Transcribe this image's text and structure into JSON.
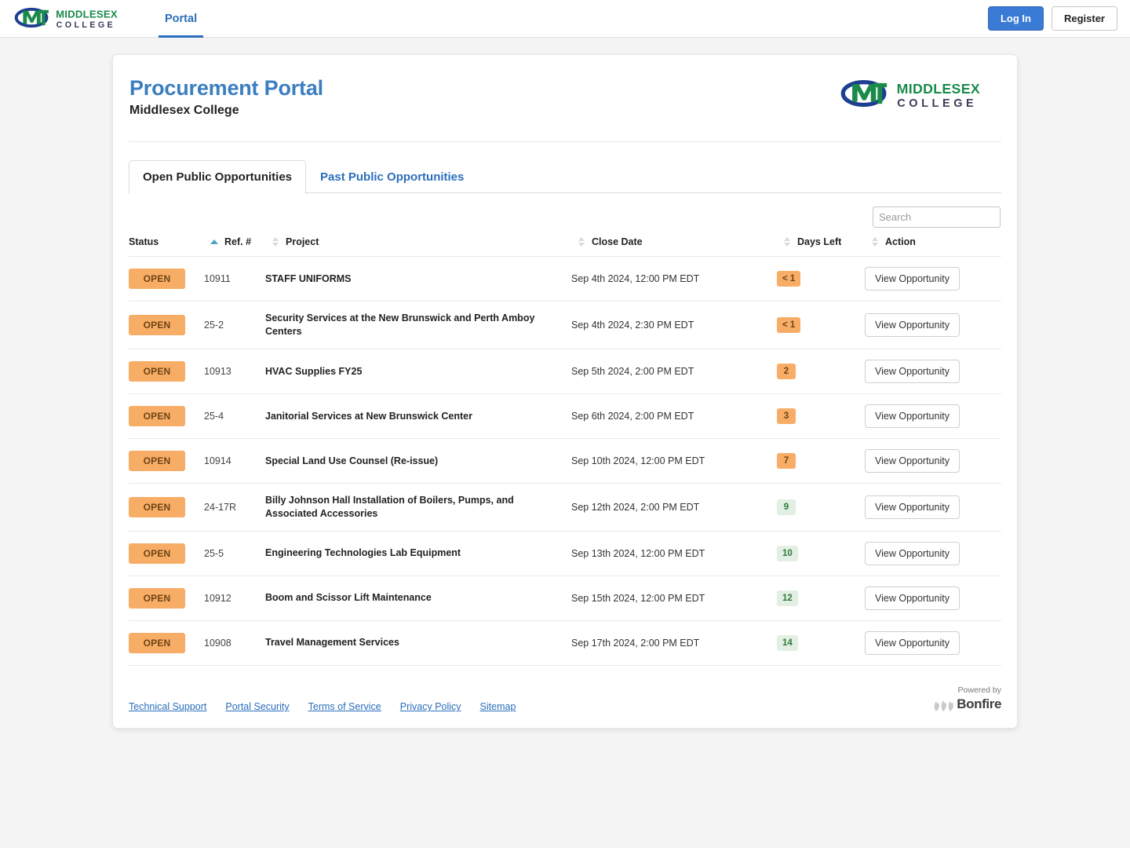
{
  "topnav": {
    "brand_line1": "MIDDLESEX",
    "brand_line2": "C O L L E G E",
    "nav_items": [
      {
        "label": "Portal",
        "active": true
      }
    ],
    "login_label": "Log In",
    "register_label": "Register"
  },
  "header": {
    "title": "Procurement Portal",
    "subtitle": "Middlesex College",
    "logo_line1": "MIDDLESEX",
    "logo_line2": "COLLEGE"
  },
  "tabs": [
    {
      "label": "Open Public Opportunities",
      "active": true
    },
    {
      "label": "Past Public Opportunities",
      "active": false
    }
  ],
  "search": {
    "value": "",
    "placeholder": "Search"
  },
  "table": {
    "columns": [
      {
        "label": "Status",
        "sort": "asc"
      },
      {
        "label": "Ref. #",
        "sort": "both"
      },
      {
        "label": "Project",
        "sort": "both"
      },
      {
        "label": "Close Date",
        "sort": "both"
      },
      {
        "label": "Days Left",
        "sort": "both"
      },
      {
        "label": "Action",
        "sort": "none"
      }
    ],
    "action_label": "View Opportunity",
    "rows": [
      {
        "status": "OPEN",
        "ref": "10911",
        "project": "STAFF UNIFORMS",
        "close_date": "Sep 4th 2024, 12:00 PM EDT",
        "days_left": "< 1",
        "days_state": "warn"
      },
      {
        "status": "OPEN",
        "ref": "25-2",
        "project": "Security Services at the New Brunswick and Perth Amboy Centers",
        "close_date": "Sep 4th 2024, 2:30 PM EDT",
        "days_left": "< 1",
        "days_state": "warn"
      },
      {
        "status": "OPEN",
        "ref": "10913",
        "project": "HVAC Supplies FY25",
        "close_date": "Sep 5th 2024, 2:00 PM EDT",
        "days_left": "2",
        "days_state": "warn"
      },
      {
        "status": "OPEN",
        "ref": "25-4",
        "project": "Janitorial Services at New Brunswick Center",
        "close_date": "Sep 6th 2024, 2:00 PM EDT",
        "days_left": "3",
        "days_state": "warn"
      },
      {
        "status": "OPEN",
        "ref": "10914",
        "project": "Special Land Use Counsel (Re-issue)",
        "close_date": "Sep 10th 2024, 12:00 PM EDT",
        "days_left": "7",
        "days_state": "warn"
      },
      {
        "status": "OPEN",
        "ref": "24-17R",
        "project": "Billy Johnson Hall Installation of Boilers, Pumps, and Associated Accessories",
        "close_date": "Sep 12th 2024, 2:00 PM EDT",
        "days_left": "9",
        "days_state": "ok"
      },
      {
        "status": "OPEN",
        "ref": "25-5",
        "project": "Engineering Technologies Lab Equipment",
        "close_date": "Sep 13th 2024, 12:00 PM EDT",
        "days_left": "10",
        "days_state": "ok"
      },
      {
        "status": "OPEN",
        "ref": "10912",
        "project": "Boom and Scissor Lift Maintenance",
        "close_date": "Sep 15th 2024, 12:00 PM EDT",
        "days_left": "12",
        "days_state": "ok"
      },
      {
        "status": "OPEN",
        "ref": "10908",
        "project": "Travel Management Services",
        "close_date": "Sep 17th 2024, 2:00 PM EDT",
        "days_left": "14",
        "days_state": "ok"
      }
    ]
  },
  "footer": {
    "links": [
      "Technical Support",
      "Portal Security",
      "Terms of Service",
      "Privacy Policy",
      "Sitemap"
    ],
    "powered_by": "Powered by",
    "brand": "Bonfire"
  },
  "colors": {
    "accent_blue": "#3a7bd5",
    "title_blue": "#3a7ec0",
    "brand_green": "#1a8b4a",
    "brand_navy": "#1d3f8f",
    "badge_orange": "#f8ad66",
    "badge_green_bg": "#e2efe2"
  }
}
